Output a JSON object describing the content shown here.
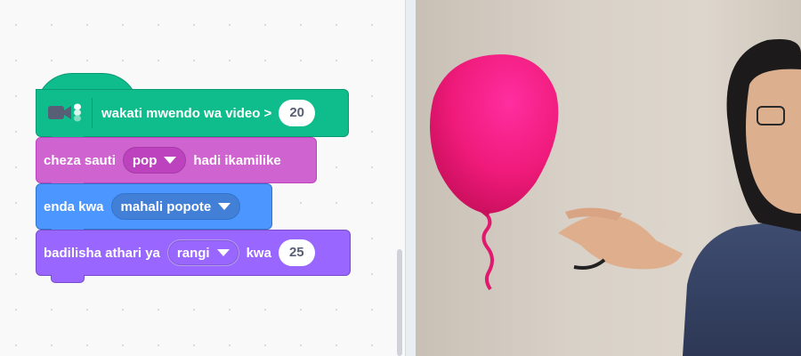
{
  "workspace": {
    "blocks": {
      "hat": {
        "label": "wakati mwendo wa video >",
        "value": "20",
        "icon": "video-sensing-extension-icon",
        "color": "#0fbd8c"
      },
      "sound": {
        "label_before": "cheza sauti",
        "dropdown": "pop",
        "label_after": "hadi ikamilike",
        "color": "#cf63cf"
      },
      "motion": {
        "label": "enda kwa",
        "dropdown": "mahali popote",
        "color": "#4c97ff"
      },
      "looks": {
        "label_before": "badilisha athari ya",
        "dropdown": "rangi",
        "label_after": "kwa",
        "value": "25",
        "color": "#9966ff"
      }
    }
  },
  "stage": {
    "scene": "webcam video showing a person holding a pink balloon",
    "balloon_color": "#ef1a7a"
  }
}
